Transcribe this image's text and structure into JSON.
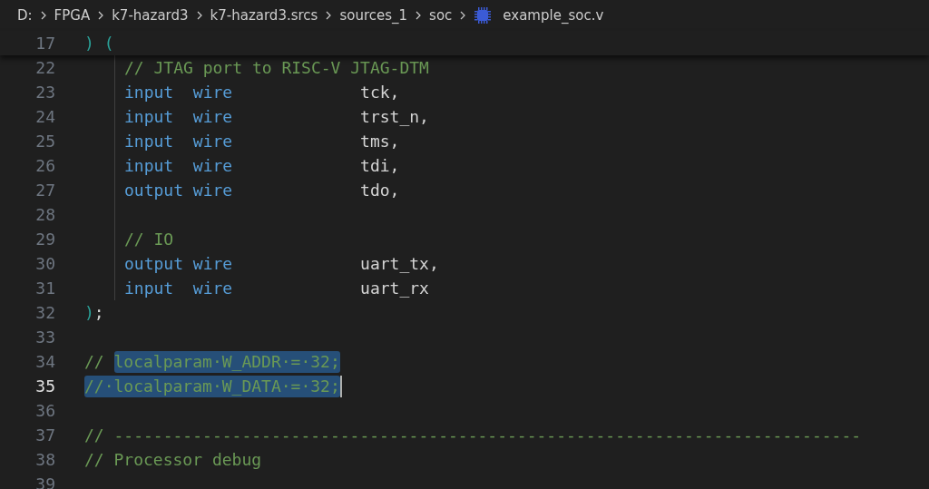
{
  "breadcrumb": {
    "segments": [
      "D:",
      "FPGA",
      "k7-hazard3",
      "k7-hazard3.srcs",
      "sources_1",
      "soc"
    ],
    "file": "example_soc.v"
  },
  "sticky_line": {
    "number": "17",
    "tokens": [
      {
        "text": ") (",
        "kind": "bracket"
      }
    ]
  },
  "lines": [
    {
      "number": "22",
      "kind": "code",
      "indent": true,
      "guide": true,
      "tokens": [
        {
          "text": "// JTAG port to RISC-V JTAG-DTM",
          "kind": "comment"
        }
      ]
    },
    {
      "number": "23",
      "kind": "port",
      "indent": true,
      "guide": true,
      "direction": "input",
      "type": "wire",
      "name": "tck,"
    },
    {
      "number": "24",
      "kind": "port",
      "indent": true,
      "guide": true,
      "direction": "input",
      "type": "wire",
      "name": "trst_n,"
    },
    {
      "number": "25",
      "kind": "port",
      "indent": true,
      "guide": true,
      "direction": "input",
      "type": "wire",
      "name": "tms,"
    },
    {
      "number": "26",
      "kind": "port",
      "indent": true,
      "guide": true,
      "direction": "input",
      "type": "wire",
      "name": "tdi,"
    },
    {
      "number": "27",
      "kind": "port",
      "indent": true,
      "guide": true,
      "direction": "output",
      "type": "wire",
      "name": "tdo,"
    },
    {
      "number": "28",
      "kind": "code",
      "guide": true
    },
    {
      "number": "29",
      "kind": "code",
      "indent": true,
      "guide": true,
      "tokens": [
        {
          "text": "// IO",
          "kind": "comment"
        }
      ]
    },
    {
      "number": "30",
      "kind": "port",
      "indent": true,
      "guide": true,
      "direction": "output",
      "type": "wire",
      "name": "uart_tx,"
    },
    {
      "number": "31",
      "kind": "port",
      "indent": true,
      "guide": true,
      "direction": "input",
      "type": "wire",
      "name": "uart_rx"
    },
    {
      "number": "32",
      "kind": "code",
      "indent": false,
      "guide": false,
      "tokens": [
        {
          "text": ")",
          "kind": "bracket"
        },
        {
          "text": ";",
          "kind": "plain"
        }
      ]
    },
    {
      "number": "33",
      "kind": "code",
      "guide": false
    },
    {
      "number": "34",
      "kind": "code",
      "indent": false,
      "guide": false,
      "tokens": [
        {
          "text": "// ",
          "kind": "comment",
          "selected": false
        },
        {
          "text": "localparam·W_ADDR·=·32;",
          "kind": "comment",
          "selected": true
        }
      ]
    },
    {
      "number": "35",
      "kind": "code",
      "indent": false,
      "guide": false,
      "current": true,
      "cursor": true,
      "tokens": [
        {
          "text": "//·localparam·W_DATA·=·32;",
          "kind": "comment",
          "selected": true
        }
      ]
    },
    {
      "number": "36",
      "kind": "code",
      "guide": false
    },
    {
      "number": "37",
      "kind": "code",
      "indent": false,
      "guide": false,
      "tokens": [
        {
          "text": "// ----------------------------------------------------------------------------",
          "kind": "comment"
        }
      ]
    },
    {
      "number": "38",
      "kind": "code",
      "indent": false,
      "guide": false,
      "tokens": [
        {
          "text": "// Processor debug",
          "kind": "comment"
        }
      ]
    },
    {
      "number": "39",
      "kind": "code",
      "guide": false
    }
  ]
}
